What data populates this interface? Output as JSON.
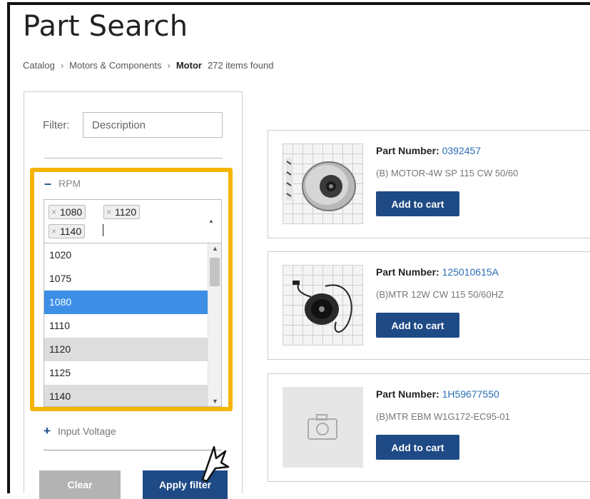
{
  "page": {
    "title": "Part Search"
  },
  "breadcrumb": {
    "items": [
      "Catalog",
      "Motors & Components"
    ],
    "current": "Motor",
    "count": "272 items found"
  },
  "filter": {
    "label": "Filter:",
    "placeholder": "Description"
  },
  "rpm": {
    "label": "RPM",
    "selected_tags": [
      "1080",
      "1120",
      "1140"
    ],
    "options": [
      {
        "value": "1020",
        "state": "normal"
      },
      {
        "value": "1075",
        "state": "normal"
      },
      {
        "value": "1080",
        "state": "highlighted"
      },
      {
        "value": "1110",
        "state": "normal"
      },
      {
        "value": "1120",
        "state": "selected"
      },
      {
        "value": "1125",
        "state": "normal"
      },
      {
        "value": "1140",
        "state": "selected"
      }
    ]
  },
  "input_voltage": {
    "label": "Input Voltage"
  },
  "buttons": {
    "clear": "Clear",
    "apply": "Apply filter"
  },
  "products": [
    {
      "part_label": "Part Number:",
      "part_number": "0392457",
      "description": "(B) MOTOR-4W SP 115 CW 50/60",
      "cart_label": "Add to cart"
    },
    {
      "part_label": "Part Number:",
      "part_number": "125010615A",
      "description": "(B)MTR 12W CW 115 50/60HZ",
      "cart_label": "Add to cart"
    },
    {
      "part_label": "Part Number:",
      "part_number": "1H59677550",
      "description": "(B)MTR EBM W1G172-EC95-01",
      "cart_label": "Add to cart"
    }
  ],
  "colors": {
    "accent": "#1e4a85",
    "highlight_border": "#f5b400",
    "option_highlight": "#3d8fe6",
    "link": "#2a6db3"
  }
}
